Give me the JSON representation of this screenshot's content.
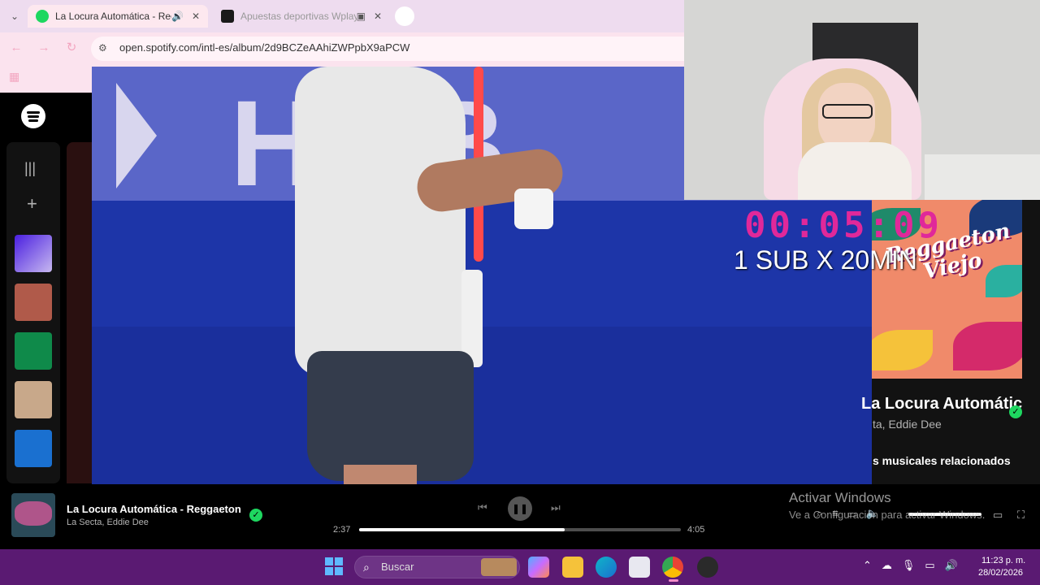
{
  "browser": {
    "tabs": [
      {
        "title": "La Locura Automática - Reg",
        "active": true
      },
      {
        "title": "Apuestas deportivas Wplay",
        "active": false
      }
    ],
    "url": "open.spotify.com/intl-es/album/2d9BCZeAAhiZWPpbX9aPCW"
  },
  "overlay": {
    "timer": "00:05:09",
    "sub_text": "1 SUB X 20MIN"
  },
  "now_playing_panel": {
    "album_art_text": "Reggaeton Viejo",
    "title": "La Locura Automátic",
    "artists": "ta, Eddie Dee",
    "related": "s musicales relacionados"
  },
  "player": {
    "title": "La Locura Automática - Reggaeton",
    "artist": "La Secta, Eddie Dee",
    "elapsed": "2:37",
    "total": "4:05",
    "progress": 0.64
  },
  "watermark": {
    "title": "Activar Windows",
    "subtitle": "Ve a Configuración para activar Windows."
  },
  "taskbar": {
    "search_placeholder": "Buscar",
    "time": "11:23 p. m.",
    "date": "28/02/2026"
  },
  "colors": {
    "spotify_green": "#1ed760",
    "timer": "#e0289a",
    "taskbar": "#5a1a72",
    "tab_strip": "#eedcef"
  }
}
